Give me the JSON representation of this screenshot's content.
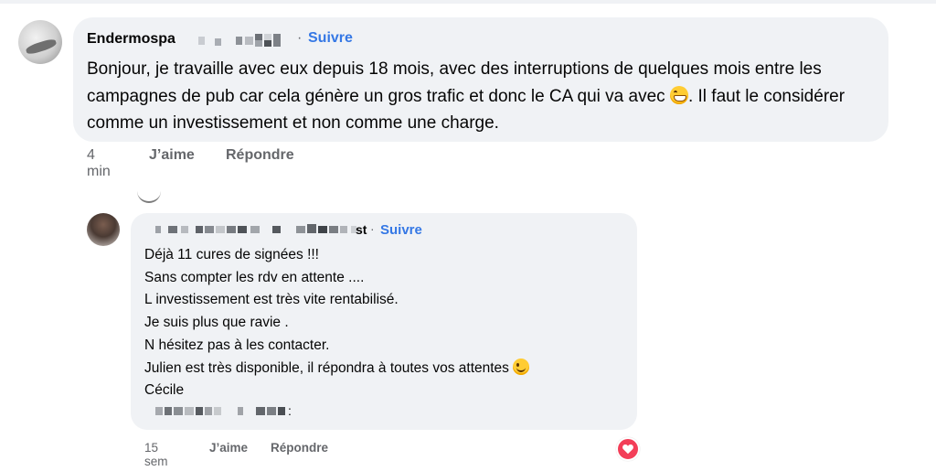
{
  "comment1": {
    "author": "Endermospa",
    "follow_label": "Suivre",
    "separator": "·",
    "text_before_emoji": "Bonjour, je travaille avec eux depuis 18 mois, avec des interruptions de quelques mois entre les campagnes de pub car cela génère un gros trafic et donc le CA qui va avec",
    "text_after_emoji": ". Il faut le considérer comme un investissement et non comme une charge.",
    "emoji_icon": "grinning-face-icon",
    "time": "4 min",
    "like_label": "J’aime",
    "reply_label": "Répondre"
  },
  "comment2": {
    "author_suffix": "st",
    "follow_label": "Suivre",
    "separator": "·",
    "lines": [
      "Déjà 11 cures de signées !!!",
      "Sans compter les rdv en attente ....",
      "L investissement est très vite rentabilisé.",
      "Je suis plus que ravie .",
      "N hésitez pas à les contacter.",
      "Julien est très disponible, il répondra à toutes vos attentes",
      "Cécile"
    ],
    "emoji_icon": "winking-face-icon",
    "signature_end": ":",
    "time": "15 sem",
    "like_label": "J’aime",
    "reply_label": "Répondre",
    "reaction_icon": "love-heart-icon"
  },
  "colors": {
    "bubble": "#f0f2f5",
    "link": "#3578e5",
    "meta": "#65676b",
    "love": "#f33e58"
  }
}
